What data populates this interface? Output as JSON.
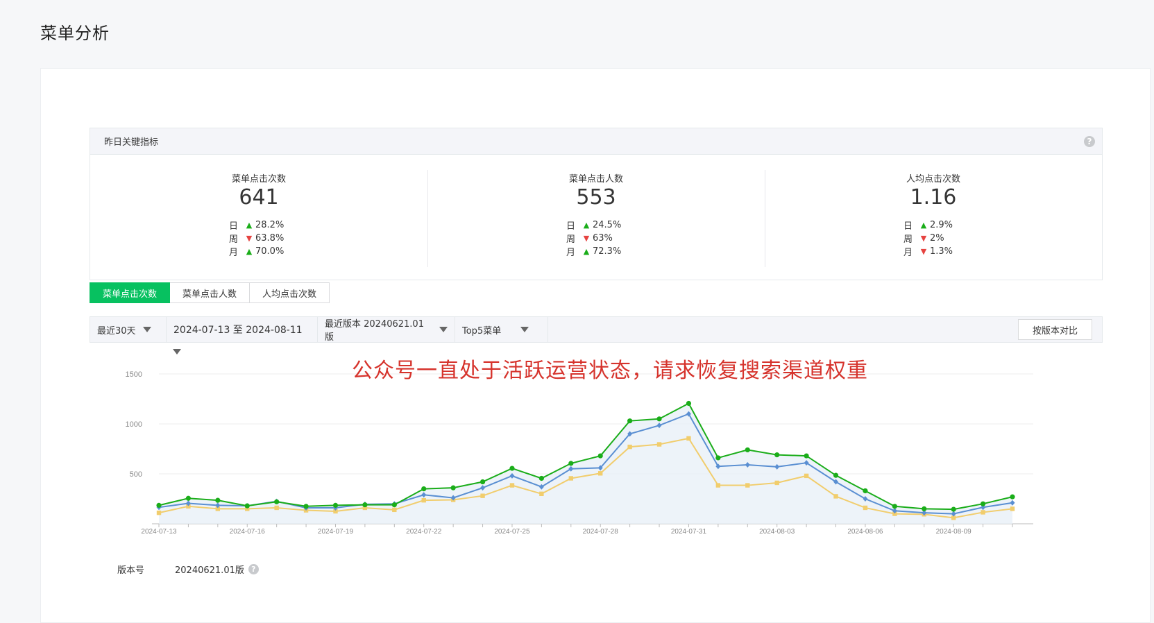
{
  "page": {
    "title": "菜单分析"
  },
  "kpi_panel": {
    "header": "昨日关键指标",
    "help_glyph": "?",
    "metrics": [
      {
        "title": "菜单点击次数",
        "value": "641",
        "rows": [
          {
            "label": "日",
            "dir": "up",
            "value": "28.2%"
          },
          {
            "label": "周",
            "dir": "down",
            "value": "63.8%"
          },
          {
            "label": "月",
            "dir": "up",
            "value": "70.0%"
          }
        ]
      },
      {
        "title": "菜单点击人数",
        "value": "553",
        "rows": [
          {
            "label": "日",
            "dir": "up",
            "value": "24.5%"
          },
          {
            "label": "周",
            "dir": "down",
            "value": "63%"
          },
          {
            "label": "月",
            "dir": "up",
            "value": "72.3%"
          }
        ]
      },
      {
        "title": "人均点击次数",
        "value": "1.16",
        "rows": [
          {
            "label": "日",
            "dir": "up",
            "value": "2.9%"
          },
          {
            "label": "周",
            "dir": "down",
            "value": "2%"
          },
          {
            "label": "月",
            "dir": "down",
            "value": "1.3%"
          }
        ]
      }
    ]
  },
  "tabs": [
    {
      "label": "菜单点击次数",
      "active": true
    },
    {
      "label": "菜单点击人数",
      "active": false
    },
    {
      "label": "人均点击次数",
      "active": false
    }
  ],
  "filters": {
    "range": "最近30天",
    "dates": "2024-07-13 至 2024-08-11",
    "version": "最近版本 20240621.01版",
    "menu": "Top5菜单",
    "compare_button": "按版本对比"
  },
  "notice": "公众号一直处于活跃运营状态，请求恢复搜索渠道权重",
  "footer": {
    "label": "版本号",
    "value": "20240621.01版",
    "help_glyph": "?"
  },
  "colors": {
    "green": "#1aad19",
    "blue": "#5a8fd2",
    "yellow": "#f1cd6d",
    "accent": "#07c160"
  },
  "chart_data": {
    "type": "line",
    "x": [
      "2024-07-13",
      "2024-07-14",
      "2024-07-15",
      "2024-07-16",
      "2024-07-17",
      "2024-07-18",
      "2024-07-19",
      "2024-07-20",
      "2024-07-21",
      "2024-07-22",
      "2024-07-23",
      "2024-07-24",
      "2024-07-25",
      "2024-07-26",
      "2024-07-27",
      "2024-07-28",
      "2024-07-29",
      "2024-07-30",
      "2024-07-31",
      "2024-08-01",
      "2024-08-02",
      "2024-08-03",
      "2024-08-04",
      "2024-08-05",
      "2024-08-06",
      "2024-08-07",
      "2024-08-08",
      "2024-08-09",
      "2024-08-10",
      "2024-08-11"
    ],
    "x_ticks": [
      "2024-07-13",
      "2024-07-16",
      "2024-07-19",
      "2024-07-22",
      "2024-07-25",
      "2024-07-28",
      "2024-07-31",
      "2024-08-03",
      "2024-08-06",
      "2024-08-09"
    ],
    "y_ticks": [
      500,
      1000,
      1500
    ],
    "ylim": [
      0,
      1500
    ],
    "grid": true,
    "series": [
      {
        "color": "#1aad19",
        "marker": "circle",
        "values": [
          185,
          255,
          235,
          180,
          220,
          175,
          185,
          190,
          190,
          350,
          360,
          420,
          555,
          455,
          605,
          680,
          1030,
          1050,
          1205,
          660,
          740,
          690,
          680,
          485,
          330,
          175,
          150,
          145,
          200,
          270
        ]
      },
      {
        "color": "#5a8fd2",
        "marker": "diamond",
        "values": [
          165,
          205,
          185,
          180,
          225,
          160,
          160,
          195,
          200,
          290,
          260,
          360,
          480,
          370,
          550,
          560,
          900,
          985,
          1100,
          575,
          590,
          570,
          610,
          420,
          250,
          130,
          110,
          100,
          165,
          210
        ]
      },
      {
        "color": "#f1cd6d",
        "marker": "square",
        "area": true,
        "values": [
          110,
          175,
          150,
          150,
          160,
          135,
          125,
          160,
          140,
          235,
          240,
          280,
          385,
          300,
          455,
          505,
          770,
          795,
          855,
          385,
          385,
          410,
          480,
          275,
          160,
          100,
          95,
          60,
          115,
          150
        ]
      }
    ]
  }
}
